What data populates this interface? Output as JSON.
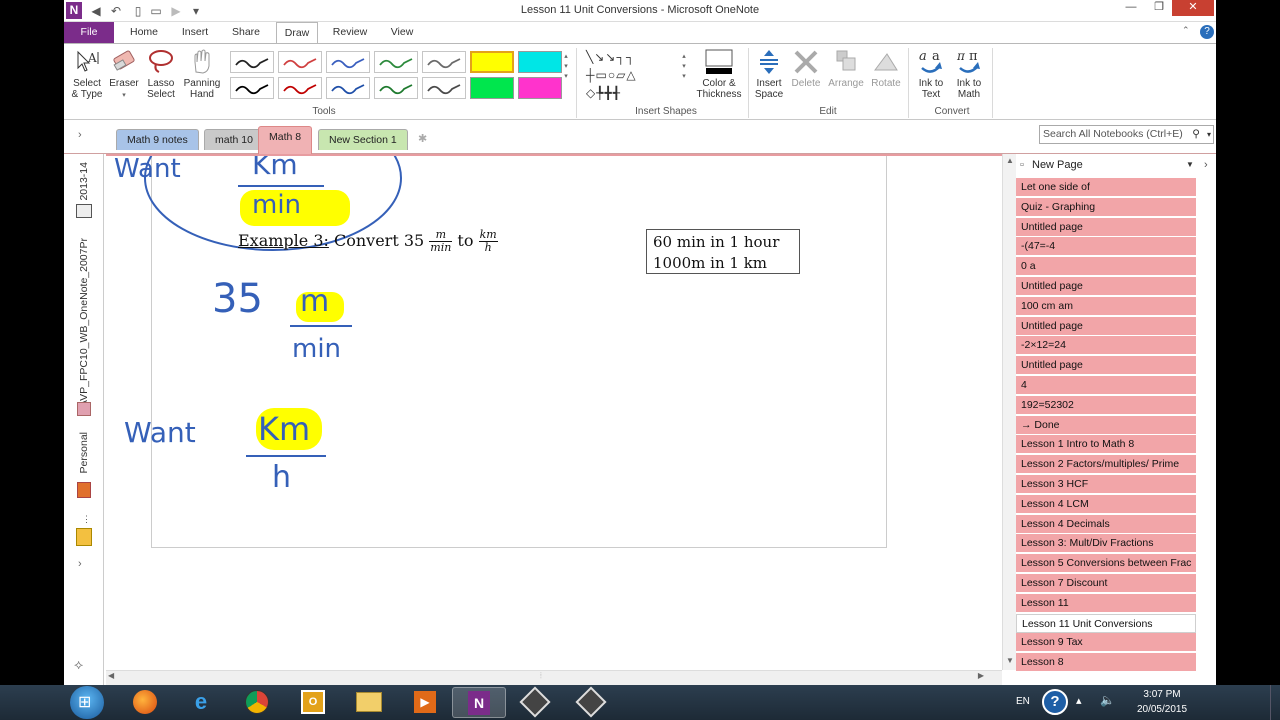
{
  "window": {
    "title": "Lesson 11 Unit Conversions - Microsoft OneNote",
    "app_logo": "N"
  },
  "ribbon_tabs": [
    "File",
    "Home",
    "Insert",
    "Share",
    "Draw",
    "Review",
    "View"
  ],
  "active_tab": "Draw",
  "ribbon": {
    "select_type": [
      "Select",
      "& Type"
    ],
    "eraser": "Eraser",
    "lasso": [
      "Lasso",
      "Select"
    ],
    "panning": [
      "Panning",
      "Hand"
    ],
    "tools_group": "Tools",
    "color_thickness": [
      "Color &",
      "Thickness"
    ],
    "insert_shapes_group": "Insert Shapes",
    "insert_space": [
      "Insert",
      "Space"
    ],
    "delete": "Delete",
    "arrange": "Arrange",
    "rotate": "Rotate",
    "edit_group": "Edit",
    "ink_to_text": [
      "Ink to",
      "Text"
    ],
    "ink_to_math": [
      "Ink to",
      "Math"
    ],
    "convert_group": "Convert",
    "pen_colors_row1": [
      "#222222",
      "#d04040",
      "#3a5fbf",
      "#2c8a3c",
      "#6a6a6a"
    ],
    "pen_colors_row2": [
      "#000000",
      "#c00000",
      "#1f4fa8",
      "#1e7a2e",
      "#4a4a4a"
    ],
    "highlighters": [
      "#ffff00",
      "#00e6e6",
      "#00e64d",
      "#ff33cc"
    ]
  },
  "sections": [
    "Math 9 notes",
    "math 10",
    "Math 8",
    "New Section 1"
  ],
  "section_colors": [
    "#a8c3e8",
    "#c9c9c9",
    "#f0b2b4",
    "#c8e6b0"
  ],
  "active_section": "Math 8",
  "search_placeholder": "Search All Notebooks (Ctrl+E)",
  "notebooks": {
    "year": "2013-14",
    "name": "AVP_FPC10_WB_OneNote_2007Pr",
    "personal": "Personal"
  },
  "page": {
    "example_label": "Example 3:",
    "convert_text": " Convert 35 ",
    "frac1_num": "m",
    "frac1_den": "min",
    "to_text": " to ",
    "frac2_num": "km",
    "frac2_den": "h",
    "fact1": "60 min in 1 hour",
    "fact2": "1000m in 1 km",
    "ink_want_top": "Want",
    "ink_km_top": "Km",
    "ink_min_top": "min",
    "ink_35": "35",
    "ink_m": "m",
    "ink_min": "min",
    "ink_want": "Want",
    "ink_km": "Km",
    "ink_h": "h"
  },
  "page_list": {
    "new_page": "New Page",
    "items": [
      "Let one side of",
      "Quiz - Graphing",
      "Untitled page",
      "-(47=-4",
      "0 a",
      "Untitled page",
      "100 cm am",
      "Untitled page",
      "-2×12=24",
      "Untitled page",
      "4",
      "192=52302",
      "→ Done",
      "Lesson 1 Intro to Math 8",
      "Lesson 2 Factors/multiples/ Prime",
      "Lesson 3 HCF",
      "Lesson 4 LCM",
      "Lesson 4 Decimals",
      "Lesson 3:  Mult/Div Fractions",
      "Lesson 5 Conversions between Frac",
      "Lesson 7 Discount",
      "Lesson 11",
      "Lesson 11 Unit Conversions",
      "Lesson 9 Tax",
      "Lesson 8"
    ],
    "active_index": 22
  },
  "taskbar": {
    "lang": "EN",
    "time": "3:07 PM",
    "date": "20/05/2015"
  }
}
